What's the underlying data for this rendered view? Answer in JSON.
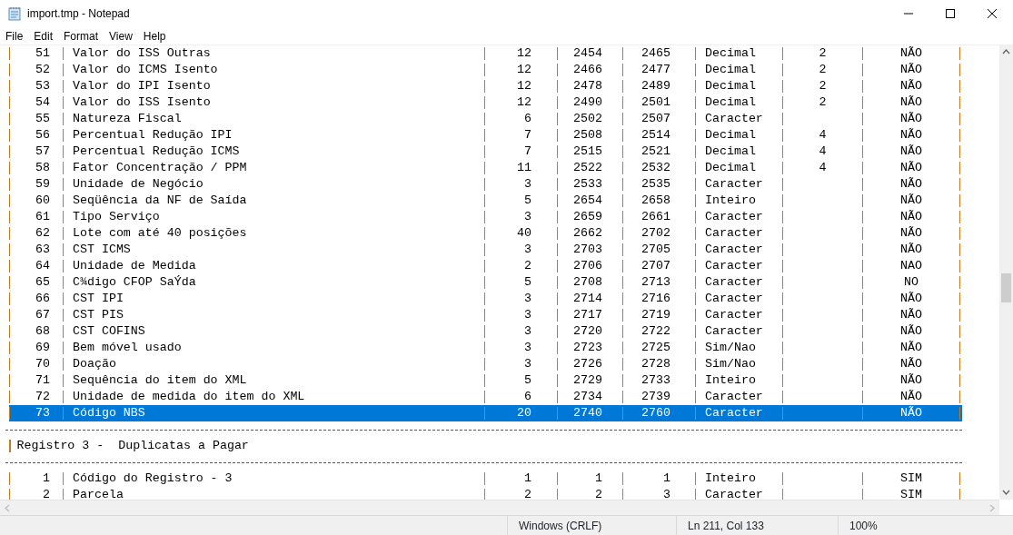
{
  "window": {
    "title": "import.tmp - Notepad"
  },
  "menu": [
    "File",
    "Edit",
    "Format",
    "View",
    "Help"
  ],
  "lines": [
    {
      "kind": "row",
      "selected": false,
      "cells": [
        "51",
        "Valor do ISS Outras",
        "12",
        "2454",
        "2465",
        "Decimal",
        "2",
        "NÃO"
      ]
    },
    {
      "kind": "row",
      "selected": false,
      "cells": [
        "52",
        "Valor do ICMS Isento",
        "12",
        "2466",
        "2477",
        "Decimal",
        "2",
        "NÃO"
      ]
    },
    {
      "kind": "row",
      "selected": false,
      "cells": [
        "53",
        "Valor do IPI Isento",
        "12",
        "2478",
        "2489",
        "Decimal",
        "2",
        "NÃO"
      ]
    },
    {
      "kind": "row",
      "selected": false,
      "cells": [
        "54",
        "Valor do ISS Isento",
        "12",
        "2490",
        "2501",
        "Decimal",
        "2",
        "NÃO"
      ]
    },
    {
      "kind": "row",
      "selected": false,
      "cells": [
        "55",
        "Natureza Fiscal",
        "6",
        "2502",
        "2507",
        "Caracter",
        null,
        "NÃO"
      ]
    },
    {
      "kind": "row",
      "selected": false,
      "cells": [
        "56",
        "Percentual Redução IPI",
        "7",
        "2508",
        "2514",
        "Decimal",
        "4",
        "NÃO"
      ]
    },
    {
      "kind": "row",
      "selected": false,
      "cells": [
        "57",
        "Percentual Redução ICMS",
        "7",
        "2515",
        "2521",
        "Decimal",
        "4",
        "NÃO"
      ]
    },
    {
      "kind": "row",
      "selected": false,
      "cells": [
        "58",
        "Fator Concentração / PPM",
        "11",
        "2522",
        "2532",
        "Decimal",
        "4",
        "NÃO"
      ]
    },
    {
      "kind": "row",
      "selected": false,
      "cells": [
        "59",
        "Unidade de Negócio",
        "3",
        "2533",
        "2535",
        "Caracter",
        null,
        "NÃO"
      ]
    },
    {
      "kind": "row",
      "selected": false,
      "cells": [
        "60",
        "Seqüência da NF de Saída",
        "5",
        "2654",
        "2658",
        "Inteiro",
        null,
        "NÃO"
      ]
    },
    {
      "kind": "row",
      "selected": false,
      "cells": [
        "61",
        "Tipo Serviço",
        "3",
        "2659",
        "2661",
        "Caracter",
        null,
        "NÃO"
      ]
    },
    {
      "kind": "row",
      "selected": false,
      "cells": [
        "62",
        "Lote com até 40 posições",
        "40",
        "2662",
        "2702",
        "Caracter",
        null,
        "NÃO"
      ]
    },
    {
      "kind": "row",
      "selected": false,
      "cells": [
        "63",
        "CST ICMS",
        "3",
        "2703",
        "2705",
        "Caracter",
        null,
        "NÃO"
      ]
    },
    {
      "kind": "row",
      "selected": false,
      "cells": [
        "64",
        "Unidade de Medida",
        "2",
        "2706",
        "2707",
        "Caracter",
        null,
        "NAO"
      ]
    },
    {
      "kind": "row",
      "selected": false,
      "cells": [
        "65",
        "C¾digo CFOP SaÝda",
        "5",
        "2708",
        "2713",
        "Caracter",
        null,
        "NO"
      ]
    },
    {
      "kind": "row",
      "selected": false,
      "cells": [
        "66",
        "CST IPI",
        "3",
        "2714",
        "2716",
        "Caracter",
        null,
        "NÃO"
      ]
    },
    {
      "kind": "row",
      "selected": false,
      "cells": [
        "67",
        "CST PIS",
        "3",
        "2717",
        "2719",
        "Caracter",
        null,
        "NÃO"
      ]
    },
    {
      "kind": "row",
      "selected": false,
      "cells": [
        "68",
        "CST COFINS",
        "3",
        "2720",
        "2722",
        "Caracter",
        null,
        "NÃO"
      ]
    },
    {
      "kind": "row",
      "selected": false,
      "cells": [
        "69",
        "Bem móvel usado",
        "3",
        "2723",
        "2725",
        "Sim/Nao",
        null,
        "NÃO"
      ]
    },
    {
      "kind": "row",
      "selected": false,
      "cells": [
        "70",
        "Doação",
        "3",
        "2726",
        "2728",
        "Sim/Nao",
        null,
        "NÃO"
      ]
    },
    {
      "kind": "row",
      "selected": false,
      "cells": [
        "71",
        "Sequência do item do XML",
        "5",
        "2729",
        "2733",
        "Inteiro",
        null,
        "NÃO"
      ]
    },
    {
      "kind": "row",
      "selected": false,
      "cells": [
        "72",
        "Unidade de medida do item do XML",
        "6",
        "2734",
        "2739",
        "Caracter",
        null,
        "NÃO"
      ]
    },
    {
      "kind": "row",
      "selected": true,
      "cells": [
        "73",
        "Código NBS",
        "20",
        "2740",
        "2760",
        "Caracter",
        null,
        "NÃO"
      ]
    },
    {
      "kind": "rule"
    },
    {
      "kind": "heading",
      "text": "Registro 3 -  Duplicatas a Pagar"
    },
    {
      "kind": "rule"
    },
    {
      "kind": "row",
      "selected": false,
      "cells": [
        "1",
        "Código do Registro - 3",
        "1",
        "1",
        "1",
        "Inteiro",
        null,
        "SIM"
      ]
    },
    {
      "kind": "row",
      "selected": false,
      "cells": [
        "2",
        "Parcela",
        "2",
        "2",
        "3",
        "Caracter",
        null,
        "SIM"
      ]
    }
  ],
  "status_bar": [
    "Windows (CRLF)",
    "Ln 211, Col 133",
    "100%"
  ]
}
